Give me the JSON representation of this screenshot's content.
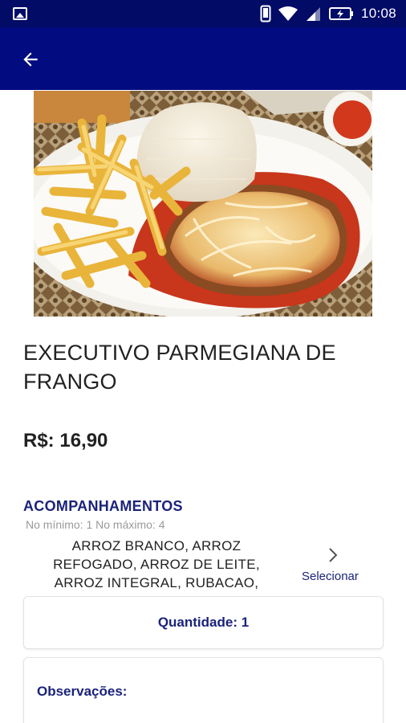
{
  "status_bar": {
    "time": "10:08"
  },
  "product": {
    "title": "EXECUTIVO PARMEGIANA DE FRANGO",
    "price": "R$: 16,90"
  },
  "accompaniments": {
    "title": "ACOMPANHAMENTOS",
    "limits": "No mínimo: 1 No máximo: 4",
    "options_text": "ARROZ BRANCO,  ARROZ REFOGADO,  ARROZ DE LEITE, ARROZ INTEGRAL,  RUBACAO,",
    "select_label": "Selecionar"
  },
  "quantity": {
    "label": "Quantidade: 1"
  },
  "notes": {
    "label": "Observações:"
  },
  "colors": {
    "status_bar": "#020b66",
    "app_bar": "#020b80",
    "accent_text": "#1b237a"
  }
}
